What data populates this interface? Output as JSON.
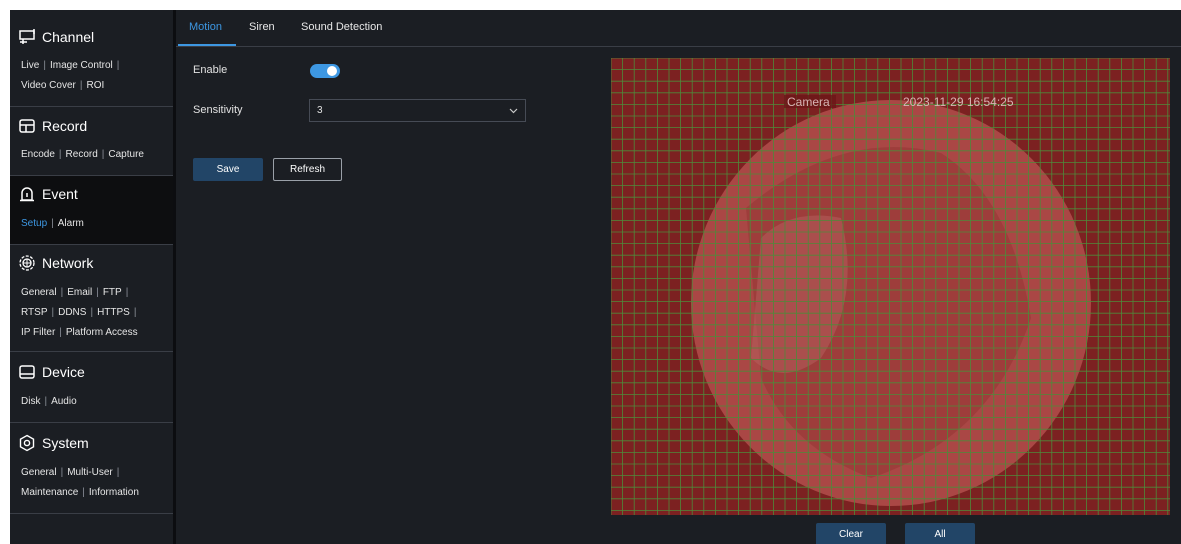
{
  "sidebar": {
    "sections": [
      {
        "title": "Channel",
        "icon": "channel-icon",
        "rows": [
          [
            "Live",
            "Image Control"
          ],
          [
            "Video Cover",
            "ROI"
          ]
        ]
      },
      {
        "title": "Record",
        "icon": "record-icon",
        "rows": [
          [
            "Encode",
            "Record",
            "Capture"
          ]
        ]
      },
      {
        "title": "Event",
        "icon": "event-icon",
        "rows": [
          [
            "Setup",
            "Alarm"
          ]
        ],
        "active_item": "Setup"
      },
      {
        "title": "Network",
        "icon": "network-icon",
        "rows": [
          [
            "General",
            "Email",
            "FTP"
          ],
          [
            "RTSP",
            "DDNS",
            "HTTPS"
          ],
          [
            "IP Filter",
            "Platform Access"
          ]
        ]
      },
      {
        "title": "Device",
        "icon": "device-icon",
        "rows": [
          [
            "Disk",
            "Audio"
          ]
        ]
      },
      {
        "title": "System",
        "icon": "system-icon",
        "rows": [
          [
            "General",
            "Multi-User"
          ],
          [
            "Maintenance",
            "Information"
          ]
        ]
      }
    ]
  },
  "tabs": [
    "Motion",
    "Siren",
    "Sound Detection"
  ],
  "active_tab": "Motion",
  "form": {
    "enable_label": "Enable",
    "enable_value": true,
    "sensitivity_label": "Sensitivity",
    "sensitivity_value": "3"
  },
  "buttons": {
    "save": "Save",
    "refresh": "Refresh",
    "clear": "Clear",
    "all": "All"
  },
  "preview": {
    "camera_label": "Camera",
    "timestamp": "2023-11-29 16:54:25"
  },
  "colors": {
    "accent": "#3d97e2",
    "button": "#224567",
    "motion_overlay": "#a0302f",
    "grid_line": "#4e8a3a"
  }
}
